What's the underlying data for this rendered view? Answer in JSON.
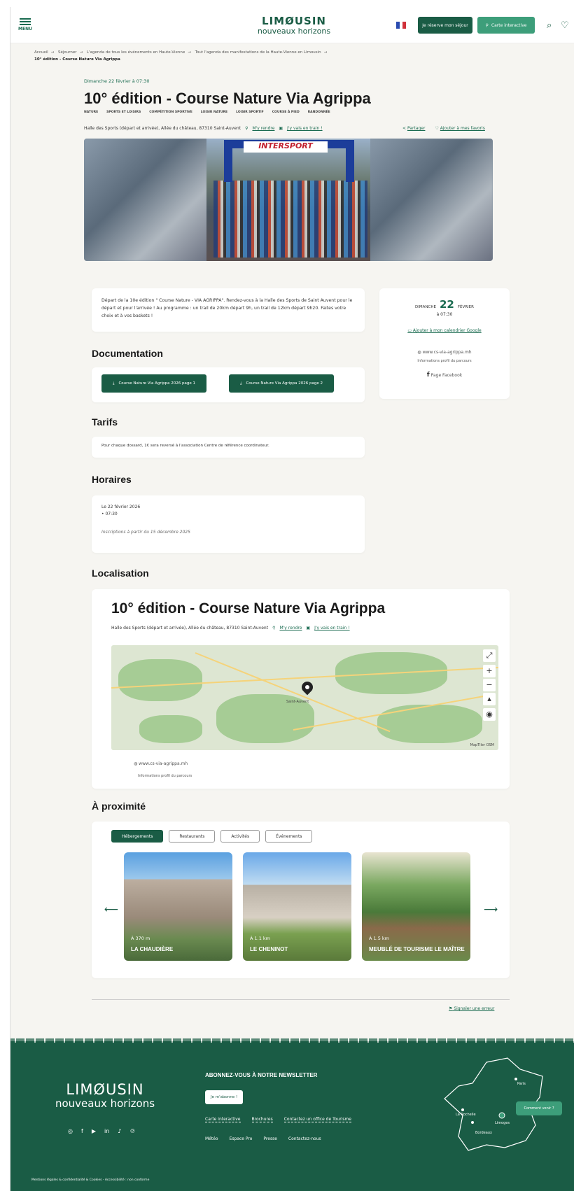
{
  "header": {
    "menu_label": "MENU",
    "logo_line1": "LIMØUSIN",
    "logo_line2": "nouveaux horizons",
    "stay_button": "Je réserve mon séjour",
    "map_button": "Carte interactive"
  },
  "breadcrumb": {
    "items": [
      "Accueil",
      "Séjourner",
      "L'agenda de tous les événements en Haute-Vienne",
      "Tout l'agenda des manifestations de la Haute-Vienne en Limousin"
    ],
    "current": "10° édition - Course Nature Via Agrippa"
  },
  "event": {
    "date_line": "Dimanche 22 février à 07:30",
    "title": "10° édition - Course Nature Via Agrippa",
    "tags": [
      "NATURE",
      "SPORTS ET LOISIRS",
      "COMPÉTITION SPORTIVE",
      "LOISIR NATURE",
      "LOISIR SPORTIF",
      "COURSE À PIED",
      "RANDONNÉE"
    ],
    "address": "Halle des Sports (départ et arrivée), Allée du château, 87310 Saint-Auvent",
    "directions_link": "M'y rendre",
    "train_link": "J'y vais en train !",
    "share_label": "Partager",
    "favorite_label": "Ajouter à mes favoris",
    "hero_sign": "INTERSPORT",
    "description": "Départ de la 10e édition \" Course Nature - VIA AGRIPPA\". Rendez-vous à la Halle des Sports de Saint Auvent pour le départ et pour l'arrivée ! Au programme : un trail de 20km départ 9h, un trail de 12km départ 9h20. Faites votre choix et à vos baskets !"
  },
  "side_card": {
    "day_word": "DIMANCHE",
    "day_number": "22",
    "month": "FÉVRIER",
    "time": "à 07:30",
    "calendar_link": "Ajouter à mon calendrier Google",
    "website": "www.cs-via-agrippa.mh",
    "profile_info": "Informations profil du parcours",
    "facebook": "Page Facebook"
  },
  "documentation": {
    "heading": "Documentation",
    "buttons": [
      "Course Nature Via Agrippa 2026 page 1",
      "Course Nature Via Agrippa 2026 page 2"
    ]
  },
  "tarifs": {
    "heading": "Tarifs",
    "text": "Pour chaque dossard, 1€ sera reversé à l'association Centre de référence coordinateur."
  },
  "horaires": {
    "heading": "Horaires",
    "date": "Le 22 février 2026",
    "time": "07:30",
    "inscriptions": "Inscriptions à partir du 15 décembre 2025"
  },
  "localisation": {
    "heading": "Localisation",
    "title": "10° édition - Course Nature Via Agrippa",
    "address": "Halle des Sports (départ et arrivée), Allée du château, 87310 Saint-Auvent",
    "directions_link": "M'y rendre",
    "train_link": "J'y vais en train !",
    "website": "www.cs-via-agrippa.mh",
    "profile_info": "Informations profil du parcours",
    "map_credit": "MapTiler OSM"
  },
  "proximite": {
    "heading": "À proximité",
    "tabs": [
      "Hébergements",
      "Restaurants",
      "Activités",
      "Événements"
    ],
    "places": [
      {
        "distance": "À 370 m",
        "name": "LA CHAUDIÈRE"
      },
      {
        "distance": "À 1.1 km",
        "name": "LE CHENINOT"
      },
      {
        "distance": "À 1.5 km",
        "name": "MEUBLÉ DE TOURISME LE MAÎTRE"
      }
    ]
  },
  "report_error": "Signaler une erreur",
  "footer": {
    "logo_line1": "LIMØUSIN",
    "logo_line2": "nouveaux horizons",
    "newsletter_heading": "ABONNEZ-VOUS À NOTRE NEWSLETTER",
    "subscribe_button": "Je m'abonne !",
    "links_row1": [
      "Carte interactive",
      "Brochures",
      "Contactez un office de Tourisme"
    ],
    "links_row2": [
      "Météo",
      "Espace Pro",
      "Presse",
      "Contactez-nous"
    ],
    "legal": "Mentions légales & confidentialité & Cookies - Accessibilité : non conforme",
    "map_cities": [
      "Paris",
      "La Rochelle",
      "Limoges",
      "Bordeaux"
    ],
    "come_button": "Comment venir ?"
  },
  "colors": {
    "brand_dark": "#1a5c45",
    "brand_light": "#3d9e7a",
    "background": "#f6f5f1"
  }
}
